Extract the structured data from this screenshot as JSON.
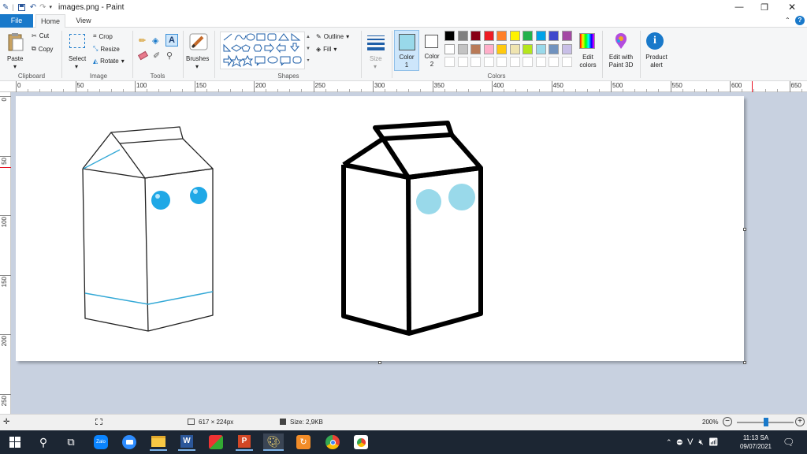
{
  "window": {
    "title": "images.png - Paint"
  },
  "tabs": [
    {
      "label": "File"
    },
    {
      "label": "Home"
    },
    {
      "label": "View"
    }
  ],
  "ribbon": {
    "clipboard": {
      "group": "Clipboard",
      "paste": "Paste",
      "cut": "Cut",
      "copy": "Copy"
    },
    "image": {
      "group": "Image",
      "select": "Select",
      "crop": "Crop",
      "resize": "Resize",
      "rotate": "Rotate"
    },
    "tools": {
      "group": "Tools"
    },
    "brushes": {
      "label": "Brushes"
    },
    "shapes": {
      "group": "Shapes",
      "outline": "Outline",
      "fill": "Fill"
    },
    "size": {
      "label": "Size"
    },
    "colors": {
      "group": "Colors",
      "color1": "Color 1",
      "color2": "Color 2",
      "color1_value": "#99d9ea",
      "color2_value": "#ffffff",
      "edit_colors": "Edit colors",
      "palette_row1": [
        "#000000",
        "#7f7f7f",
        "#880015",
        "#ed1c24",
        "#ff7f27",
        "#fff200",
        "#22b14c",
        "#00a2e8",
        "#3f48cc",
        "#a349a4"
      ],
      "palette_row2": [
        "#ffffff",
        "#c3c3c3",
        "#b97a57",
        "#ffaec9",
        "#ffc90e",
        "#efe4b0",
        "#b5e61d",
        "#99d9ea",
        "#7092be",
        "#c8bfe7"
      ]
    },
    "paint3d": {
      "label": "Edit with Paint 3D"
    },
    "alert": {
      "label": "Product alert"
    }
  },
  "ruler": {
    "h_ticks": [
      "0",
      "50",
      "100",
      "150",
      "200",
      "250",
      "300",
      "350",
      "400",
      "450",
      "500",
      "550",
      "600",
      "650"
    ],
    "v_ticks": [
      "0",
      "50",
      "100",
      "150",
      "200",
      "250"
    ]
  },
  "status": {
    "dimensions": "617 × 224px",
    "size": "Size: 2,9KB",
    "zoom": "200%"
  },
  "taskbar": {
    "time": "11:13 SA",
    "date": "09/07/2021",
    "lang": "V"
  }
}
